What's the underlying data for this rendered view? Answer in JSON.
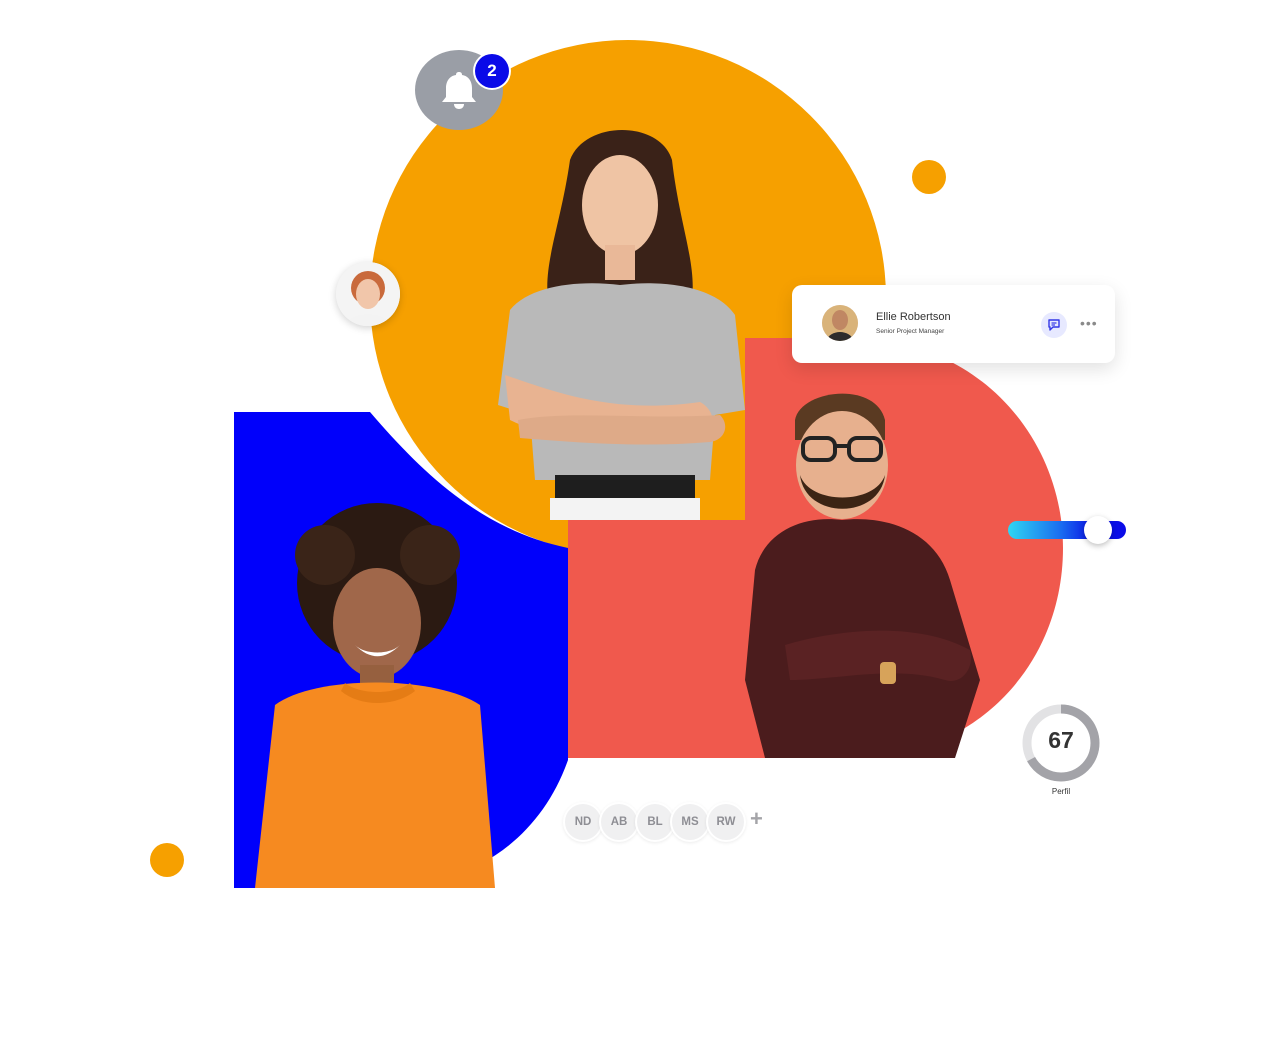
{
  "notification": {
    "count": "2",
    "icon": "bell-icon"
  },
  "profile_card": {
    "name": "Ellie Robertson",
    "role": "Senior Project Manager",
    "actions": [
      "chat-icon",
      "more-icon"
    ]
  },
  "gauge": {
    "value": "67",
    "label": "Perfil",
    "fraction": 0.67
  },
  "slider": {
    "level": 0.76
  },
  "team": {
    "initials": [
      "ND",
      "AB",
      "BL",
      "MS",
      "RW"
    ],
    "add_label": "+"
  },
  "colors": {
    "orange": "#f6a000",
    "blue": "#0000fb",
    "red": "#f0594d",
    "gray": "#9a9ea6"
  }
}
